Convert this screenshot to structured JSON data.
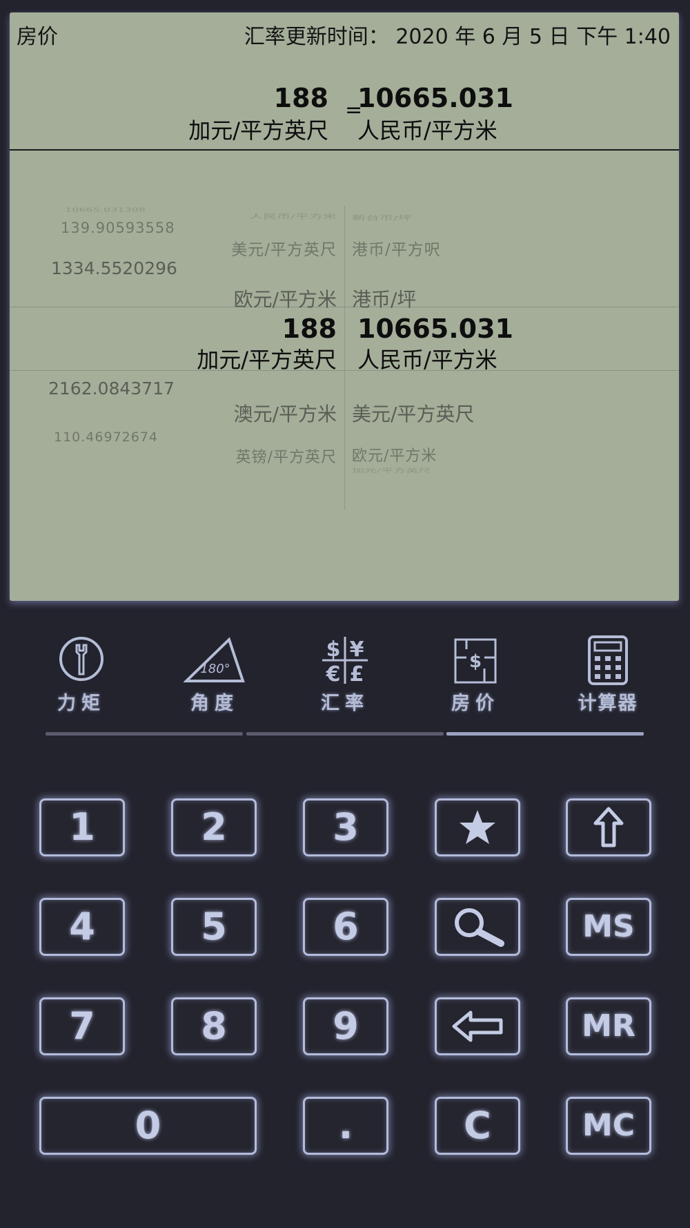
{
  "header": {
    "mode_title": "房价",
    "update_label": "汇率更新时间：  2020 年 6 月 5 日 下午 1:40"
  },
  "result": {
    "from_value": "188",
    "from_unit": "加元/平方英尺",
    "equals": "=",
    "to_value": "10665.031",
    "to_unit": "人民币/平方米"
  },
  "picker": {
    "left": [
      {
        "value": "10665.031308",
        "unit": "人民币/平方米"
      },
      {
        "value": "139.90593558",
        "unit": "美元/平方英尺"
      },
      {
        "value": "1334.5520296",
        "unit": "欧元/平方米"
      },
      {
        "value": "188",
        "unit": "加元/平方英尺"
      },
      {
        "value": "2162.0843717",
        "unit": "澳元/平方米"
      },
      {
        "value": "110.46972674",
        "unit": "英镑/平方英尺"
      }
    ],
    "right": [
      {
        "unit": "新台币/坪"
      },
      {
        "unit": "港币/平方呎"
      },
      {
        "unit": "港币/坪"
      },
      {
        "value": "10665.031",
        "unit": "人民币/平方米"
      },
      {
        "unit": "美元/平方英尺"
      },
      {
        "unit": "欧元/平方米"
      },
      {
        "unit": "加元/平方英尺"
      }
    ]
  },
  "modes": [
    {
      "label": "力矩",
      "icon": "wrench-icon"
    },
    {
      "label": "角度",
      "icon": "triangle-angle-icon",
      "icon_text": "180°"
    },
    {
      "label": "汇率",
      "icon": "currency-icon",
      "icon_text": [
        "$",
        "¥",
        "€",
        "£"
      ]
    },
    {
      "label": "房价",
      "icon": "house-price-icon",
      "icon_text": "$"
    },
    {
      "label": "计算器",
      "icon": "calculator-icon"
    }
  ],
  "active_mode": "房价",
  "keypad": {
    "k1": "1",
    "k2": "2",
    "k3": "3",
    "k4": "4",
    "k5": "5",
    "k6": "6",
    "k7": "7",
    "k8": "8",
    "k9": "9",
    "k0": "0",
    "dot": ".",
    "clear": "C",
    "ms": "MS",
    "mr": "MR",
    "mc": "MC",
    "favorite_icon": "star-icon",
    "shift_icon": "up-arrow-icon",
    "search_icon": "magnifier-icon",
    "backspace_icon": "left-arrow-icon"
  },
  "colors": {
    "background": "#23232e",
    "display": "#a4ae99",
    "key_glow": "#b4bcdc"
  }
}
